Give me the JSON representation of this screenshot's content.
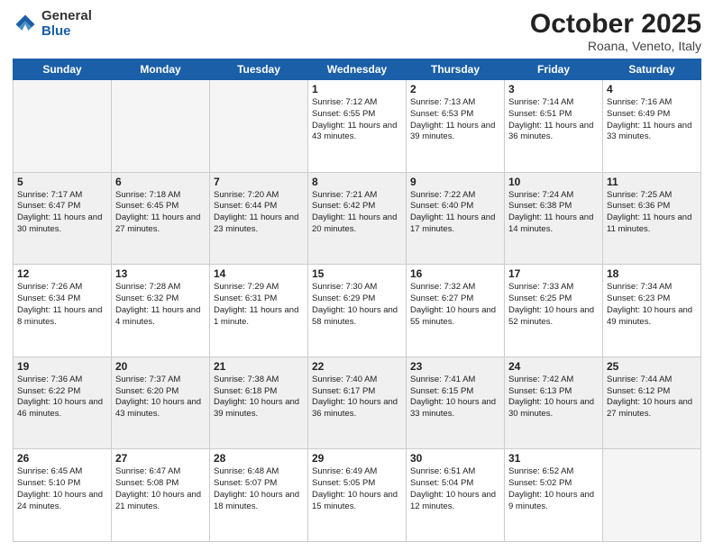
{
  "logo": {
    "general": "General",
    "blue": "Blue"
  },
  "header": {
    "month": "October 2025",
    "location": "Roana, Veneto, Italy"
  },
  "weekdays": [
    "Sunday",
    "Monday",
    "Tuesday",
    "Wednesday",
    "Thursday",
    "Friday",
    "Saturday"
  ],
  "weeks": [
    [
      {
        "day": "",
        "text": "",
        "empty": true
      },
      {
        "day": "",
        "text": "",
        "empty": true
      },
      {
        "day": "",
        "text": "",
        "empty": true
      },
      {
        "day": "1",
        "text": "Sunrise: 7:12 AM\nSunset: 6:55 PM\nDaylight: 11 hours\nand 43 minutes."
      },
      {
        "day": "2",
        "text": "Sunrise: 7:13 AM\nSunset: 6:53 PM\nDaylight: 11 hours\nand 39 minutes."
      },
      {
        "day": "3",
        "text": "Sunrise: 7:14 AM\nSunset: 6:51 PM\nDaylight: 11 hours\nand 36 minutes."
      },
      {
        "day": "4",
        "text": "Sunrise: 7:16 AM\nSunset: 6:49 PM\nDaylight: 11 hours\nand 33 minutes."
      }
    ],
    [
      {
        "day": "5",
        "text": "Sunrise: 7:17 AM\nSunset: 6:47 PM\nDaylight: 11 hours\nand 30 minutes."
      },
      {
        "day": "6",
        "text": "Sunrise: 7:18 AM\nSunset: 6:45 PM\nDaylight: 11 hours\nand 27 minutes."
      },
      {
        "day": "7",
        "text": "Sunrise: 7:20 AM\nSunset: 6:44 PM\nDaylight: 11 hours\nand 23 minutes."
      },
      {
        "day": "8",
        "text": "Sunrise: 7:21 AM\nSunset: 6:42 PM\nDaylight: 11 hours\nand 20 minutes."
      },
      {
        "day": "9",
        "text": "Sunrise: 7:22 AM\nSunset: 6:40 PM\nDaylight: 11 hours\nand 17 minutes."
      },
      {
        "day": "10",
        "text": "Sunrise: 7:24 AM\nSunset: 6:38 PM\nDaylight: 11 hours\nand 14 minutes."
      },
      {
        "day": "11",
        "text": "Sunrise: 7:25 AM\nSunset: 6:36 PM\nDaylight: 11 hours\nand 11 minutes."
      }
    ],
    [
      {
        "day": "12",
        "text": "Sunrise: 7:26 AM\nSunset: 6:34 PM\nDaylight: 11 hours\nand 8 minutes."
      },
      {
        "day": "13",
        "text": "Sunrise: 7:28 AM\nSunset: 6:32 PM\nDaylight: 11 hours\nand 4 minutes."
      },
      {
        "day": "14",
        "text": "Sunrise: 7:29 AM\nSunset: 6:31 PM\nDaylight: 11 hours\nand 1 minute."
      },
      {
        "day": "15",
        "text": "Sunrise: 7:30 AM\nSunset: 6:29 PM\nDaylight: 10 hours\nand 58 minutes."
      },
      {
        "day": "16",
        "text": "Sunrise: 7:32 AM\nSunset: 6:27 PM\nDaylight: 10 hours\nand 55 minutes."
      },
      {
        "day": "17",
        "text": "Sunrise: 7:33 AM\nSunset: 6:25 PM\nDaylight: 10 hours\nand 52 minutes."
      },
      {
        "day": "18",
        "text": "Sunrise: 7:34 AM\nSunset: 6:23 PM\nDaylight: 10 hours\nand 49 minutes."
      }
    ],
    [
      {
        "day": "19",
        "text": "Sunrise: 7:36 AM\nSunset: 6:22 PM\nDaylight: 10 hours\nand 46 minutes."
      },
      {
        "day": "20",
        "text": "Sunrise: 7:37 AM\nSunset: 6:20 PM\nDaylight: 10 hours\nand 43 minutes."
      },
      {
        "day": "21",
        "text": "Sunrise: 7:38 AM\nSunset: 6:18 PM\nDaylight: 10 hours\nand 39 minutes."
      },
      {
        "day": "22",
        "text": "Sunrise: 7:40 AM\nSunset: 6:17 PM\nDaylight: 10 hours\nand 36 minutes."
      },
      {
        "day": "23",
        "text": "Sunrise: 7:41 AM\nSunset: 6:15 PM\nDaylight: 10 hours\nand 33 minutes."
      },
      {
        "day": "24",
        "text": "Sunrise: 7:42 AM\nSunset: 6:13 PM\nDaylight: 10 hours\nand 30 minutes."
      },
      {
        "day": "25",
        "text": "Sunrise: 7:44 AM\nSunset: 6:12 PM\nDaylight: 10 hours\nand 27 minutes."
      }
    ],
    [
      {
        "day": "26",
        "text": "Sunrise: 6:45 AM\nSunset: 5:10 PM\nDaylight: 10 hours\nand 24 minutes."
      },
      {
        "day": "27",
        "text": "Sunrise: 6:47 AM\nSunset: 5:08 PM\nDaylight: 10 hours\nand 21 minutes."
      },
      {
        "day": "28",
        "text": "Sunrise: 6:48 AM\nSunset: 5:07 PM\nDaylight: 10 hours\nand 18 minutes."
      },
      {
        "day": "29",
        "text": "Sunrise: 6:49 AM\nSunset: 5:05 PM\nDaylight: 10 hours\nand 15 minutes."
      },
      {
        "day": "30",
        "text": "Sunrise: 6:51 AM\nSunset: 5:04 PM\nDaylight: 10 hours\nand 12 minutes."
      },
      {
        "day": "31",
        "text": "Sunrise: 6:52 AM\nSunset: 5:02 PM\nDaylight: 10 hours\nand 9 minutes."
      },
      {
        "day": "",
        "text": "",
        "empty": true
      }
    ]
  ]
}
